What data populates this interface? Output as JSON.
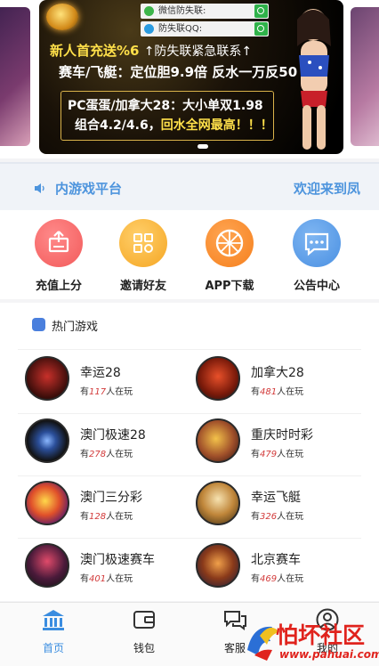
{
  "banner": {
    "field1_text": "微信防失联:",
    "field2_text": "防失联QQ:",
    "line1_a": "新人首充送%6",
    "line1_b": "↑防失联紧急联系↑",
    "line2": "赛车/飞艇：定位胆9.9倍 反水一万反50",
    "line3": "PC蛋蛋/加拿大28：大小单双1.98",
    "line4_a": "组合4.2/4.6，",
    "line4_b": "回水全网最高！！！"
  },
  "marquee": {
    "left_text": "内游戏平台",
    "right_text": "欢迎来到凤"
  },
  "actions": [
    {
      "label": "充值上分",
      "icon": "recharge-icon",
      "color": "#f25a5a"
    },
    {
      "label": "邀请好友",
      "icon": "qrcode-icon",
      "color": "#f5a623"
    },
    {
      "label": "APP下载",
      "icon": "orange-slice-icon",
      "color": "#f5801e"
    },
    {
      "label": "公告中心",
      "icon": "message-icon",
      "color": "#4a90e2"
    }
  ],
  "hot": {
    "title": "热门游戏",
    "games": [
      {
        "name": "幸运28",
        "prefix": "有",
        "count": "117",
        "suffix": "人在玩"
      },
      {
        "name": "加拿大28",
        "prefix": "有",
        "count": "481",
        "suffix": "人在玩"
      },
      {
        "name": "澳门极速28",
        "prefix": "有",
        "count": "278",
        "suffix": "人在玩"
      },
      {
        "name": "重庆时时彩",
        "prefix": "有",
        "count": "479",
        "suffix": "人在玩"
      },
      {
        "name": "澳门三分彩",
        "prefix": "有",
        "count": "128",
        "suffix": "人在玩"
      },
      {
        "name": "幸运飞艇",
        "prefix": "有",
        "count": "326",
        "suffix": "人在玩"
      },
      {
        "name": "澳门极速赛车",
        "prefix": "有",
        "count": "401",
        "suffix": "人在玩"
      },
      {
        "name": "北京赛车",
        "prefix": "有",
        "count": "469",
        "suffix": "人在玩"
      }
    ]
  },
  "tabs": [
    {
      "label": "首页",
      "icon": "bank-icon",
      "active": true
    },
    {
      "label": "钱包",
      "icon": "wallet-icon",
      "active": false
    },
    {
      "label": "客服",
      "icon": "chat-icon",
      "active": false
    },
    {
      "label": "我的",
      "icon": "user-icon",
      "active": false
    }
  ],
  "watermark": {
    "text": "怕坏社区",
    "url": "www.pahuai.com"
  },
  "colors": {
    "accent": "#3b8de0",
    "count_red": "#d23a3a",
    "banner_gold": "#ffe04a"
  }
}
